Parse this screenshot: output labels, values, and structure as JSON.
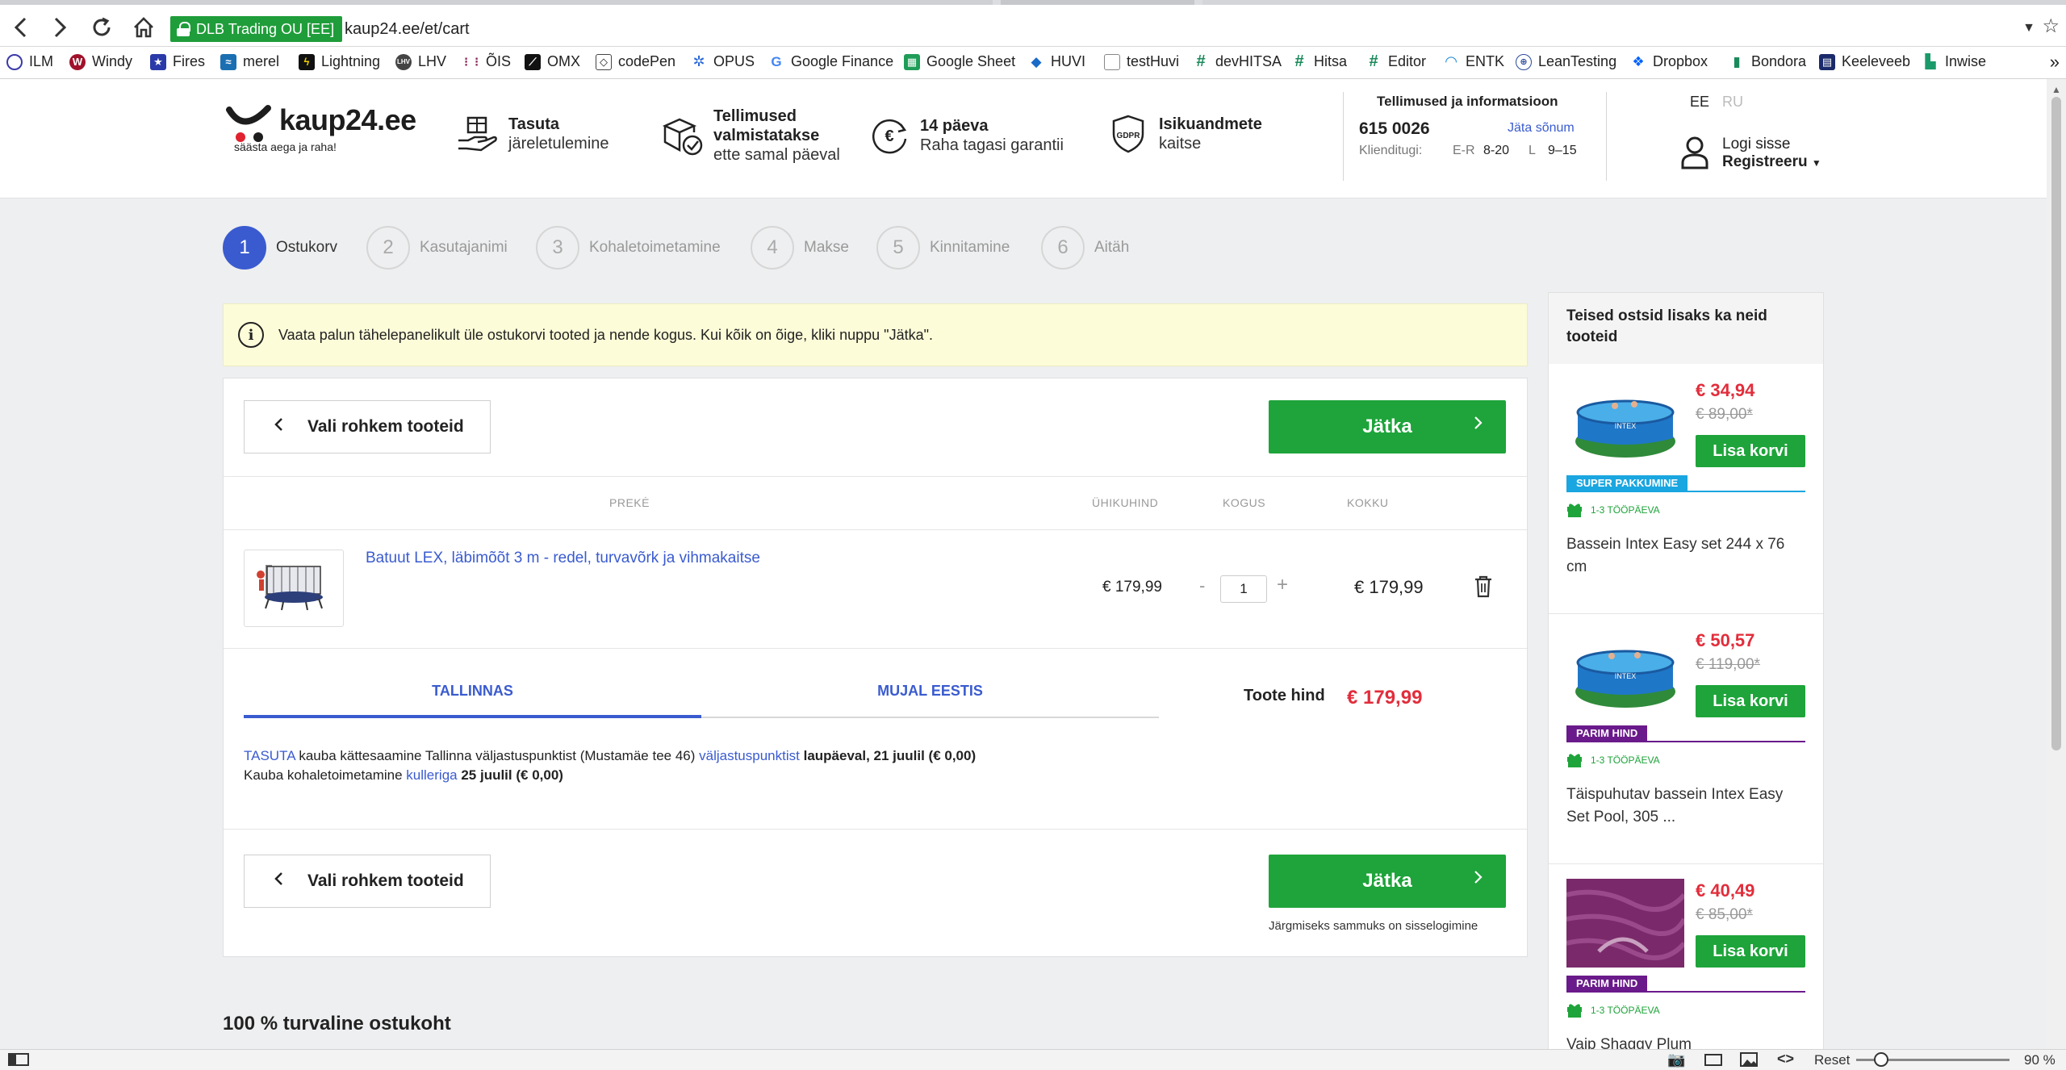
{
  "browser": {
    "back_icon": "arrow-left-icon",
    "forward_icon": "arrow-right-icon",
    "reload_icon": "reload-icon",
    "home_icon": "home-icon",
    "secure_label": "DLB Trading OU [EE]",
    "url": "kaup24.ee/et/cart",
    "bookmarks": [
      "ILM",
      "Windy",
      "Fires",
      "merel",
      "Lightning",
      "LHV",
      "ÕIS",
      "OMX",
      "codePen",
      "OPUS",
      "Google Finance",
      "Google Sheet",
      "HUVI",
      "testHuvi",
      "devHITSA",
      "Hitsa",
      "Editor",
      "ENTK",
      "LeanTesting",
      "Dropbox",
      "Bondora",
      "Keeleveeb",
      "Inwise"
    ],
    "zoom": "90 %",
    "reset_label": "Reset"
  },
  "header": {
    "logo_text": "kaup24.ee",
    "logo_tagline": "säästa aega ja raha!",
    "features": [
      {
        "line1": "Tasuta",
        "line2": "järeletulemine"
      },
      {
        "line1": "Tellimused",
        "line1b": "valmistatakse",
        "line2": "ette samal päeval"
      },
      {
        "line1": "14 päeva",
        "line2": "Raha tagasi garantii"
      },
      {
        "line1": "Isikuandmete",
        "line2": "kaitse"
      }
    ],
    "gdpr_label": "GDPR",
    "info_title": "Tellimused ja informatsioon",
    "phone": "615 0026",
    "leave_message": "Jäta sõnum",
    "support_label": "Klienditugi:",
    "hours_weekday_label": "E-R",
    "hours_weekday": "8-20",
    "hours_sat_label": "L",
    "hours_sat": "9–15",
    "lang_ee": "EE",
    "lang_ru": "RU",
    "login": "Logi sisse",
    "register": "Registreeru"
  },
  "steps": [
    {
      "num": "1",
      "label": "Ostukorv"
    },
    {
      "num": "2",
      "label": "Kasutajanimi"
    },
    {
      "num": "3",
      "label": "Kohaletoimetamine"
    },
    {
      "num": "4",
      "label": "Makse"
    },
    {
      "num": "5",
      "label": "Kinnitamine"
    },
    {
      "num": "6",
      "label": "Aitäh"
    }
  ],
  "notice": "Vaata palun tähelepanelikult üle ostukorvi tooted ja nende kogus. Kui kõik on õige, kliki nuppu \"Jätka\".",
  "cart": {
    "back_button": "Vali rohkem tooteid",
    "continue_button": "Jätka",
    "columns": {
      "product": "PREKĖ",
      "unit_price": "ÜHIKUHIND",
      "quantity": "KOGUS",
      "total": "KOKKU"
    },
    "item": {
      "name": "Batuut LEX, läbimõõt 3 m - redel, turvavõrk ja vihmakaitse",
      "unit_price": "€ 179,99",
      "quantity": "1",
      "total": "€ 179,99"
    },
    "tabs": [
      "TALLINNAS",
      "MUJAL EESTIS"
    ],
    "product_price_label": "Toote hind",
    "product_price": "€ 179,99",
    "delivery": {
      "free": "TASUTA",
      "pickup_text": " kauba kättesaamine Tallinna väljastuspunktist (Mustamäe tee 46) ",
      "pickup_link": "väljastuspunktist",
      "pickup_date": "laupäeval, 21 juulil (€ 0,00)",
      "courier_text": "Kauba kohaletoimetamine ",
      "courier_link": "kulleriga",
      "courier_date": " 25 juulil (€ 0,00)"
    },
    "next_step_note": "Järgmiseks sammuks on sisselogimine"
  },
  "trust_heading": "100 % turvaline ostukoht",
  "sidebar": {
    "title": "Teised ostsid lisaks ka neid tooteid",
    "add_label": "Lisa korvi",
    "products": [
      {
        "price": "€ 34,94",
        "old_price": "€ 89,00*",
        "badge": "SUPER PAKKUMINE",
        "badge_color": "#1aa6e0",
        "days": "1-3 TÖÖPÄEVA",
        "name": "Bassein Intex Easy set 244 x 76 cm"
      },
      {
        "price": "€ 50,57",
        "old_price": "€ 119,00*",
        "badge": "PARIM HIND",
        "badge_color": "#6a1a8a",
        "days": "1-3 TÖÖPÄEVA",
        "name": "Täispuhutav bassein Intex Easy Set Pool, 305 ..."
      },
      {
        "price": "€ 40,49",
        "old_price": "€ 85,00*",
        "badge": "PARIM HIND",
        "badge_color": "#6a1a8a",
        "days": "1-3 TÖÖPÄEVA",
        "name": "Vaip Shaggy Plum"
      }
    ]
  },
  "colors": {
    "accent_blue": "#3a5bcf",
    "green": "#1ea43a",
    "price_red": "#e22d3b",
    "notice_bg": "#fcfcd9"
  }
}
